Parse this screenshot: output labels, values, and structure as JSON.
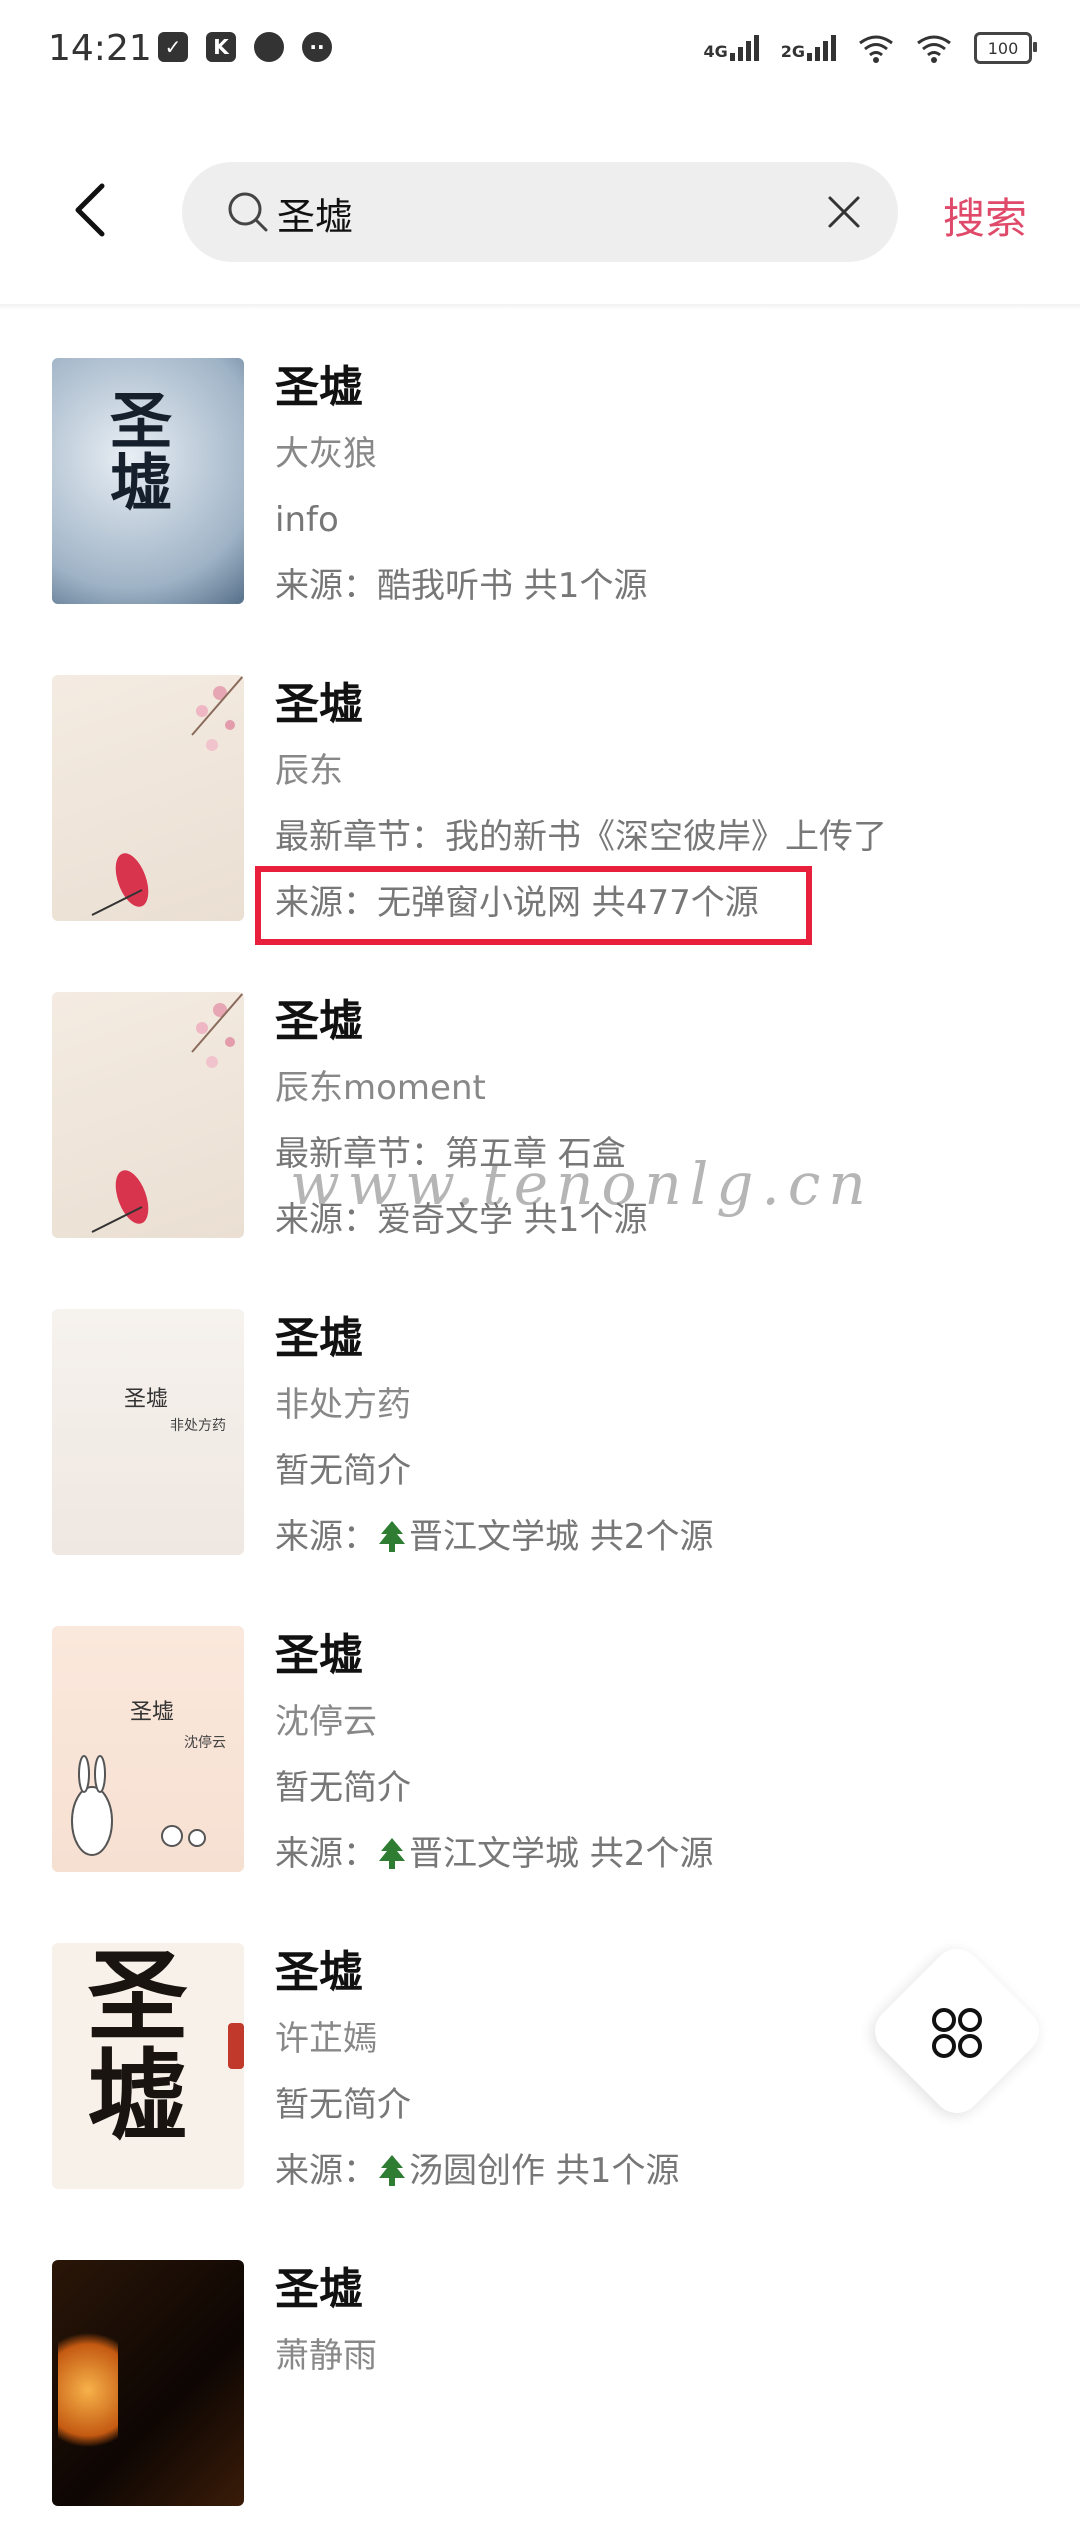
{
  "status_bar": {
    "time": "14:21",
    "left_icons": [
      "clipboard-check-icon",
      "k-app-icon",
      "chat-bubble-icon",
      "wechat-icon"
    ],
    "network1": "4G",
    "network2": "2G",
    "battery": "100"
  },
  "header": {
    "search_value": "圣墟",
    "search_button": "搜索"
  },
  "books": [
    {
      "title": "圣墟",
      "author": "大灰狼",
      "meta": "info",
      "source": "来源：酷我听书 共1个源",
      "source_has_tree": false,
      "cover": {
        "text": "圣墟",
        "style": "ink-blue"
      }
    },
    {
      "title": "圣墟",
      "author": "辰东",
      "meta": "最新章节：我的新书《深空彼岸》上传了",
      "source": "来源：无弹窗小说网 共477个源",
      "source_has_tree": false,
      "cover": {
        "text": "",
        "style": "plum"
      }
    },
    {
      "title": "圣墟",
      "author": "辰东moment",
      "meta": "最新章节：第五章 石盒",
      "source": "来源：爱奇文学 共1个源",
      "source_has_tree": false,
      "cover": {
        "text": "",
        "style": "plum"
      }
    },
    {
      "title": "圣墟",
      "author": "非处方药",
      "meta": "暂无简介",
      "source": "来源：",
      "source_tail": "晋江文学城 共2个源",
      "source_has_tree": true,
      "cover": {
        "text": "圣墟",
        "sub": "非处方药",
        "style": "pale"
      }
    },
    {
      "title": "圣墟",
      "author": "沈停云",
      "meta": "暂无简介",
      "source": "来源：",
      "source_tail": "晋江文学城 共2个源",
      "source_has_tree": true,
      "cover": {
        "text": "圣墟",
        "sub": "沈停云",
        "style": "bunny"
      }
    },
    {
      "title": "圣墟",
      "author": "许芷嫣",
      "meta": "暂无简介",
      "source": "来源：",
      "source_tail": "汤圆创作 共1个源",
      "source_has_tree": true,
      "cover": {
        "text": "圣墟",
        "style": "calligraphy"
      }
    },
    {
      "title": "圣墟",
      "author": "萧静雨",
      "meta": "",
      "source": "",
      "source_has_tree": false,
      "cover": {
        "text": "",
        "style": "fire"
      }
    }
  ],
  "watermark": "www.tenonlg.cn",
  "colors": {
    "accent": "#e04a6a",
    "highlight": "#e8203c"
  }
}
